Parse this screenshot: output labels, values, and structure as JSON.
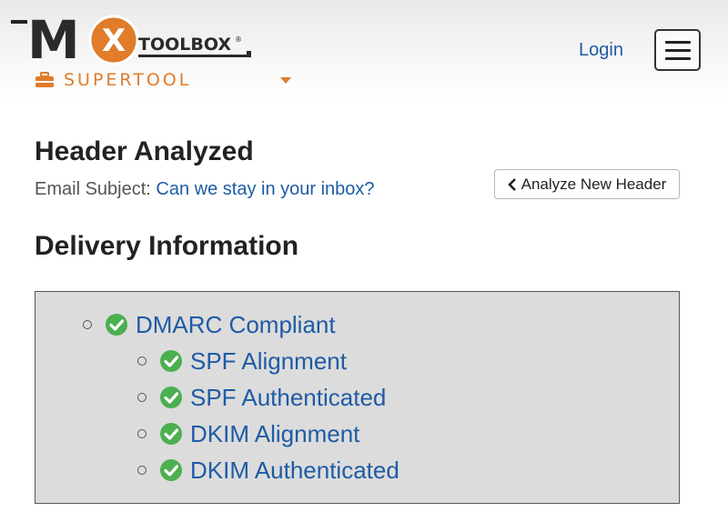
{
  "header": {
    "logo_text": "MXTOOLBOX",
    "logo_mark": "MX",
    "logo_word": "TOOLBOX",
    "product": "SUPERTOOL",
    "login": "Login"
  },
  "main": {
    "title": "Header Analyzed",
    "subject_label": "Email Subject:",
    "subject_value": "Can we stay in your inbox?",
    "analyze_button": "Analyze New Header",
    "section_title": "Delivery Information",
    "delivery_items": [
      {
        "label": "DMARC Compliant",
        "status": "pass",
        "level": 0
      },
      {
        "label": "SPF Alignment",
        "status": "pass",
        "level": 1
      },
      {
        "label": "SPF Authenticated",
        "status": "pass",
        "level": 1
      },
      {
        "label": "DKIM Alignment",
        "status": "pass",
        "level": 1
      },
      {
        "label": "DKIM Authenticated",
        "status": "pass",
        "level": 1
      }
    ]
  },
  "colors": {
    "brand_orange": "#e07c2a",
    "link_blue": "#1f5ba5",
    "pass_green": "#4caf50",
    "box_gray": "#dcdcdc"
  },
  "icons": {
    "check": "check-circle-icon",
    "menu": "hamburger-menu-icon",
    "toolbox": "toolbox-icon",
    "back": "chevron-left-icon"
  }
}
